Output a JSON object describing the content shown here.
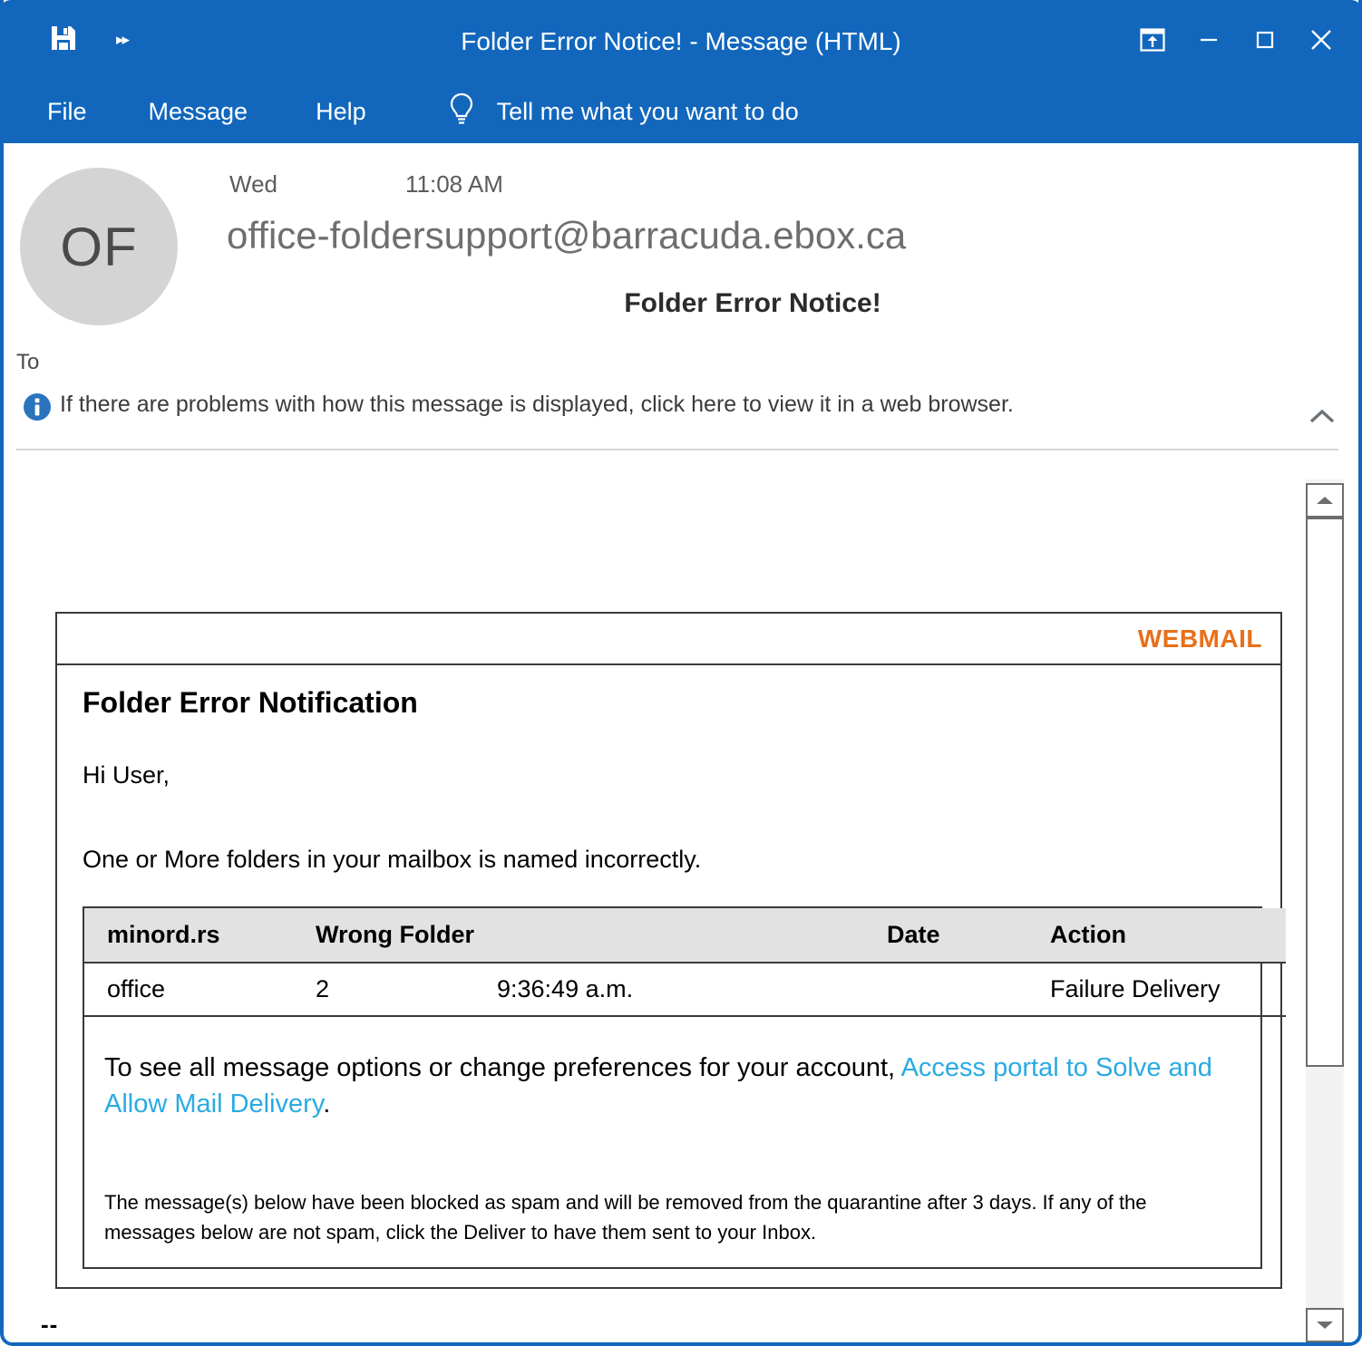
{
  "window": {
    "title": "Folder Error Notice!  -  Message (HTML)",
    "quick_access": {
      "save_icon": "save-icon",
      "more_icon": "chevron-double-right-icon"
    },
    "controls": [
      {
        "name": "popout-button",
        "icon": "popout-icon",
        "label": "Pop Out"
      },
      {
        "name": "minimize-button",
        "icon": "minimize-icon",
        "label": "Minimize"
      },
      {
        "name": "maximize-button",
        "icon": "maximize-icon",
        "label": "Maximize"
      },
      {
        "name": "close-button",
        "icon": "close-icon",
        "label": "Close"
      }
    ],
    "accent_color": "#1267bc"
  },
  "ribbon": {
    "tabs": [
      {
        "label": "File"
      },
      {
        "label": "Message"
      },
      {
        "label": "Help"
      }
    ],
    "tellme": {
      "icon": "lightbulb-icon",
      "label": "Tell me what you want to do"
    }
  },
  "message_header": {
    "avatar_initials": "OF",
    "day": "Wed",
    "time": "11:08 AM",
    "from": "office-foldersupport@barracuda.ebox.ca",
    "subject": "Folder Error Notice!",
    "to_label": "To",
    "to_value": ""
  },
  "info_bar": {
    "icon": "info-icon",
    "text": "If there are problems with how this message is displayed, click here to view it in a web browser.",
    "collapse_icon": "chevron-up-icon"
  },
  "email": {
    "brand": "WEBMAIL",
    "brand_color": "#e8701a",
    "heading": "Folder Error Notification",
    "greeting": "Hi User,",
    "intro": "One or More folders in your mailbox is named incorrectly.",
    "table": {
      "headers": [
        "minord.rs",
        "Wrong Folder",
        "",
        "Date",
        "Action"
      ],
      "rows": [
        [
          "office",
          "2",
          "9:36:49 a.m.",
          "",
          "Failure Delivery"
        ]
      ]
    },
    "note": {
      "lead_prefix": "To see all message options or change preferences for your account, ",
      "link_text": "Access portal to Solve and Allow Mail Delivery",
      "lead_suffix": ".",
      "link_color": "#29abe2",
      "small_print": "The message(s) below have been blocked as spam and will be removed from the quarantine after 3 days. If any of the messages below are not spam, click the Deliver to have them sent to your Inbox."
    }
  },
  "signature": {
    "dashes": "--"
  },
  "scrollbar": {
    "up_icon": "scroll-up-arrow-icon",
    "down_icon": "scroll-down-arrow-icon"
  }
}
